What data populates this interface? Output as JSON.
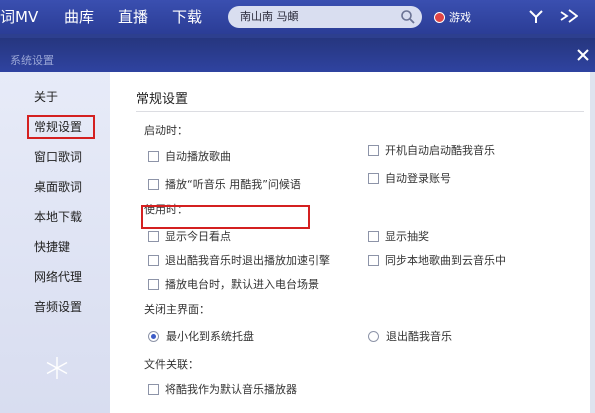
{
  "app": {
    "nav": [
      "词MV",
      "曲库",
      "直播",
      "下载"
    ],
    "search": {
      "value": "南山南  马頔"
    },
    "game_label": "游戏"
  },
  "dialog": {
    "title": "系统设置",
    "sidebar": {
      "items": [
        "关于",
        "常规设置",
        "窗口歌词",
        "桌面歌词",
        "本地下载",
        "快捷键",
        "网络代理",
        "音频设置"
      ],
      "selected": "常规设置"
    },
    "content": {
      "title": "常规设置",
      "startup": {
        "label": "启动时：",
        "options": [
          {
            "label": "自动播放歌曲",
            "checked": false
          },
          {
            "label": "开机自动启动酷我音乐",
            "checked": false
          },
          {
            "label": "播放“听音乐 用酷我”问候语",
            "checked": false
          },
          {
            "label": "自动登录账号",
            "checked": false
          }
        ]
      },
      "usage": {
        "label": "使用时：",
        "options": [
          {
            "label": "显示今日看点",
            "checked": false
          },
          {
            "label": "显示抽奖",
            "checked": false
          },
          {
            "label": "退出酷我音乐时退出播放加速引擎",
            "checked": false
          },
          {
            "label": "同步本地歌曲到云音乐中",
            "checked": false
          },
          {
            "label": "播放电台时，默认进入电台场景",
            "checked": false
          }
        ]
      },
      "close_main": {
        "label": "关闭主界面：",
        "options": [
          {
            "label": "最小化到系统托盘",
            "selected": true
          },
          {
            "label": "退出酷我音乐",
            "selected": false
          }
        ]
      },
      "file_assoc": {
        "label": "文件关联：",
        "options": [
          {
            "label": "将酷我作为默认音乐播放器",
            "checked": false
          }
        ]
      }
    }
  },
  "colors": {
    "accent": "#2d3f8e",
    "highlight": "#d42020"
  }
}
